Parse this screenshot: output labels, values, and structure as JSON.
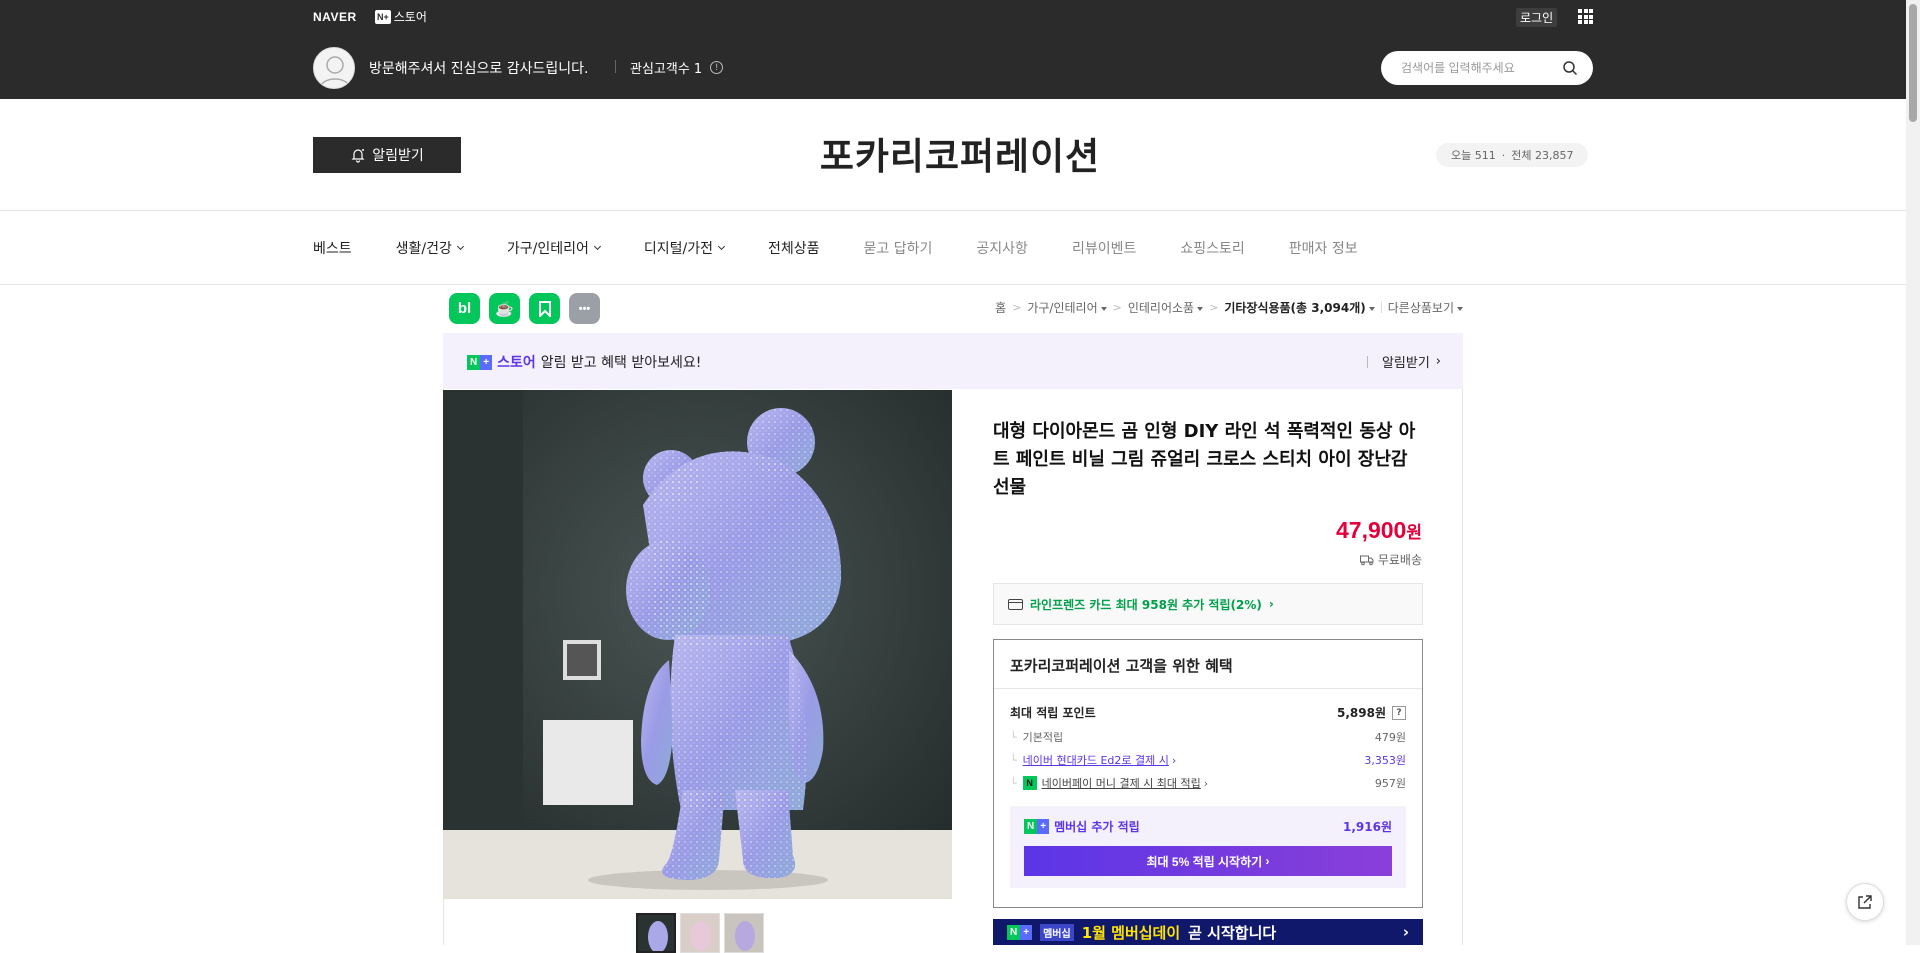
{
  "header": {
    "naver_logo": "NAVER",
    "store_badge": "N+",
    "store_label": "스토어",
    "login_label": "로그인",
    "apps_icon": "grid-icon",
    "greeting": "방문해주셔서 진심으로 감사드립니다.",
    "interest_label": "관심고객수 1",
    "search_placeholder": "검색어를 입력해주세요"
  },
  "store": {
    "notify_label": "알림받기",
    "name": "포카리코퍼레이션",
    "visit_today": "오늘 511",
    "visit_total": "전체 23,857"
  },
  "nav": [
    {
      "label": "베스트",
      "dropdown": false,
      "muted": false
    },
    {
      "label": "생활/건강",
      "dropdown": true,
      "muted": false
    },
    {
      "label": "가구/인테리어",
      "dropdown": true,
      "muted": false
    },
    {
      "label": "디지털/가전",
      "dropdown": true,
      "muted": false
    },
    {
      "label": "전체상품",
      "dropdown": false,
      "muted": false
    },
    {
      "label": "묻고 답하기",
      "dropdown": false,
      "muted": true
    },
    {
      "label": "공지사항",
      "dropdown": false,
      "muted": true
    },
    {
      "label": "리뷰이벤트",
      "dropdown": false,
      "muted": true
    },
    {
      "label": "쇼핑스토리",
      "dropdown": false,
      "muted": true
    },
    {
      "label": "판매자 정보",
      "dropdown": false,
      "muted": true
    }
  ],
  "share_buttons": [
    {
      "name": "blog-share-icon",
      "text": "bl",
      "color": "#03c75a"
    },
    {
      "name": "cafe-share-icon",
      "text": "☕",
      "color": "#03c75a"
    },
    {
      "name": "bookmark-share-icon",
      "text": "",
      "color": "#03c75a"
    },
    {
      "name": "more-share-icon",
      "text": "•••",
      "color": "#9aa0a6"
    }
  ],
  "breadcrumb": {
    "home": "홈",
    "cat1": "가구/인테리어",
    "cat2": "인테리어소품",
    "current": "기타장식용품(총 3,094개)",
    "other": "다른상품보기"
  },
  "promo": {
    "store_word": "스토어",
    "message": "알림 받고 혜택 받아보세요!",
    "action": "알림받기"
  },
  "product": {
    "title": "대형 다이아몬드 곰 인형 DIY 라인 석 폭력적인 동상 아트 페인트 비닐 그림 쥬얼리 크로스 스티치 아이 장난감 선물",
    "price": "47,900",
    "price_unit": "원",
    "shipping": "무료배송",
    "card_benefit": "라인프렌즈 카드 최대 958원 추가 적립(2%)"
  },
  "benefits": {
    "heading": "포카리코퍼레이션 고객을 위한 혜택",
    "max_points_label": "최대 적립 포인트",
    "max_points_value": "5,898원",
    "rows": [
      {
        "label": "기본적립",
        "value": "479원"
      },
      {
        "label": "네이버 현대카드 Ed2로 결제 시",
        "value": "3,353원"
      },
      {
        "label": "네이버페이 머니 결제 시 최대 적립",
        "value": "957원"
      }
    ],
    "membership_label": "멤버십 추가 적립",
    "membership_value": "1,916원",
    "membership_button": "최대 5% 적립 시작하기"
  },
  "banner": {
    "badge": "멤버십",
    "text": "1월 멤버십데이",
    "suffix": "곧 시작합니다"
  },
  "colors": {
    "dark_header": "#2b2b2b",
    "price_red": "#e4003a",
    "naver_green": "#03c75a",
    "membership_purple": "#5c35e6"
  }
}
